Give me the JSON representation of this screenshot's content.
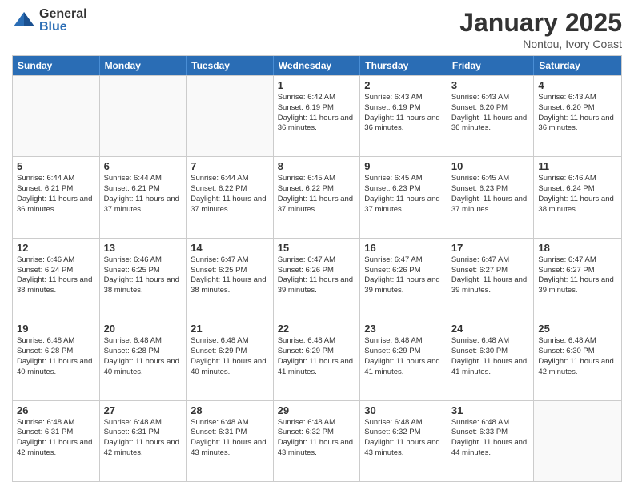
{
  "logo": {
    "general": "General",
    "blue": "Blue"
  },
  "header": {
    "month": "January 2025",
    "location": "Nontou, Ivory Coast"
  },
  "weekdays": [
    "Sunday",
    "Monday",
    "Tuesday",
    "Wednesday",
    "Thursday",
    "Friday",
    "Saturday"
  ],
  "rows": [
    [
      {
        "day": "",
        "empty": true
      },
      {
        "day": "",
        "empty": true
      },
      {
        "day": "",
        "empty": true
      },
      {
        "day": "1",
        "sunrise": "6:42 AM",
        "sunset": "6:19 PM",
        "daylight": "11 hours and 36 minutes."
      },
      {
        "day": "2",
        "sunrise": "6:43 AM",
        "sunset": "6:19 PM",
        "daylight": "11 hours and 36 minutes."
      },
      {
        "day": "3",
        "sunrise": "6:43 AM",
        "sunset": "6:20 PM",
        "daylight": "11 hours and 36 minutes."
      },
      {
        "day": "4",
        "sunrise": "6:43 AM",
        "sunset": "6:20 PM",
        "daylight": "11 hours and 36 minutes."
      }
    ],
    [
      {
        "day": "5",
        "sunrise": "6:44 AM",
        "sunset": "6:21 PM",
        "daylight": "11 hours and 36 minutes."
      },
      {
        "day": "6",
        "sunrise": "6:44 AM",
        "sunset": "6:21 PM",
        "daylight": "11 hours and 37 minutes."
      },
      {
        "day": "7",
        "sunrise": "6:44 AM",
        "sunset": "6:22 PM",
        "daylight": "11 hours and 37 minutes."
      },
      {
        "day": "8",
        "sunrise": "6:45 AM",
        "sunset": "6:22 PM",
        "daylight": "11 hours and 37 minutes."
      },
      {
        "day": "9",
        "sunrise": "6:45 AM",
        "sunset": "6:23 PM",
        "daylight": "11 hours and 37 minutes."
      },
      {
        "day": "10",
        "sunrise": "6:45 AM",
        "sunset": "6:23 PM",
        "daylight": "11 hours and 37 minutes."
      },
      {
        "day": "11",
        "sunrise": "6:46 AM",
        "sunset": "6:24 PM",
        "daylight": "11 hours and 38 minutes."
      }
    ],
    [
      {
        "day": "12",
        "sunrise": "6:46 AM",
        "sunset": "6:24 PM",
        "daylight": "11 hours and 38 minutes."
      },
      {
        "day": "13",
        "sunrise": "6:46 AM",
        "sunset": "6:25 PM",
        "daylight": "11 hours and 38 minutes."
      },
      {
        "day": "14",
        "sunrise": "6:47 AM",
        "sunset": "6:25 PM",
        "daylight": "11 hours and 38 minutes."
      },
      {
        "day": "15",
        "sunrise": "6:47 AM",
        "sunset": "6:26 PM",
        "daylight": "11 hours and 39 minutes."
      },
      {
        "day": "16",
        "sunrise": "6:47 AM",
        "sunset": "6:26 PM",
        "daylight": "11 hours and 39 minutes."
      },
      {
        "day": "17",
        "sunrise": "6:47 AM",
        "sunset": "6:27 PM",
        "daylight": "11 hours and 39 minutes."
      },
      {
        "day": "18",
        "sunrise": "6:47 AM",
        "sunset": "6:27 PM",
        "daylight": "11 hours and 39 minutes."
      }
    ],
    [
      {
        "day": "19",
        "sunrise": "6:48 AM",
        "sunset": "6:28 PM",
        "daylight": "11 hours and 40 minutes."
      },
      {
        "day": "20",
        "sunrise": "6:48 AM",
        "sunset": "6:28 PM",
        "daylight": "11 hours and 40 minutes."
      },
      {
        "day": "21",
        "sunrise": "6:48 AM",
        "sunset": "6:29 PM",
        "daylight": "11 hours and 40 minutes."
      },
      {
        "day": "22",
        "sunrise": "6:48 AM",
        "sunset": "6:29 PM",
        "daylight": "11 hours and 41 minutes."
      },
      {
        "day": "23",
        "sunrise": "6:48 AM",
        "sunset": "6:29 PM",
        "daylight": "11 hours and 41 minutes."
      },
      {
        "day": "24",
        "sunrise": "6:48 AM",
        "sunset": "6:30 PM",
        "daylight": "11 hours and 41 minutes."
      },
      {
        "day": "25",
        "sunrise": "6:48 AM",
        "sunset": "6:30 PM",
        "daylight": "11 hours and 42 minutes."
      }
    ],
    [
      {
        "day": "26",
        "sunrise": "6:48 AM",
        "sunset": "6:31 PM",
        "daylight": "11 hours and 42 minutes."
      },
      {
        "day": "27",
        "sunrise": "6:48 AM",
        "sunset": "6:31 PM",
        "daylight": "11 hours and 42 minutes."
      },
      {
        "day": "28",
        "sunrise": "6:48 AM",
        "sunset": "6:31 PM",
        "daylight": "11 hours and 43 minutes."
      },
      {
        "day": "29",
        "sunrise": "6:48 AM",
        "sunset": "6:32 PM",
        "daylight": "11 hours and 43 minutes."
      },
      {
        "day": "30",
        "sunrise": "6:48 AM",
        "sunset": "6:32 PM",
        "daylight": "11 hours and 43 minutes."
      },
      {
        "day": "31",
        "sunrise": "6:48 AM",
        "sunset": "6:33 PM",
        "daylight": "11 hours and 44 minutes."
      },
      {
        "day": "",
        "empty": true
      }
    ]
  ]
}
